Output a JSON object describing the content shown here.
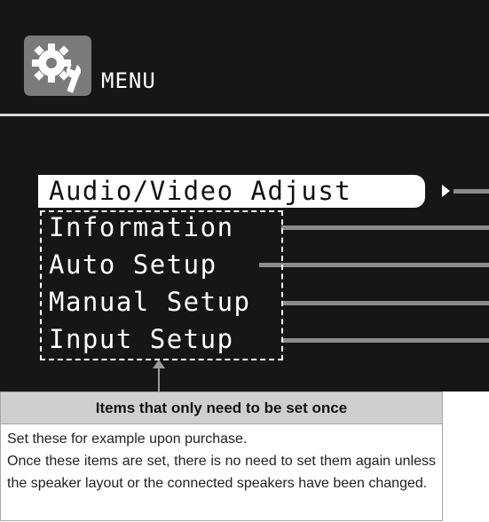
{
  "menu_header": {
    "title": "MENU",
    "icon": "gear-wrench-icon"
  },
  "menu_items": [
    {
      "label": "Audio/Video Adjust",
      "selected": true
    },
    {
      "label": "Information",
      "selected": false
    },
    {
      "label": "Auto Setup",
      "selected": false
    },
    {
      "label": "Manual Setup",
      "selected": false
    },
    {
      "label": "Input Setup",
      "selected": false
    }
  ],
  "note": {
    "heading": "Items that only need to be set once",
    "body": "Set these for example upon purchase.\nOnce these items are set, there is no need to set them again unless the speaker layout or the connected speakers have been changed."
  },
  "colors": {
    "screen_bg": "#161616",
    "icon_bg": "#7b7b7b",
    "connector": "#8c8c8c",
    "note_header_bg": "#cfcfcf"
  }
}
